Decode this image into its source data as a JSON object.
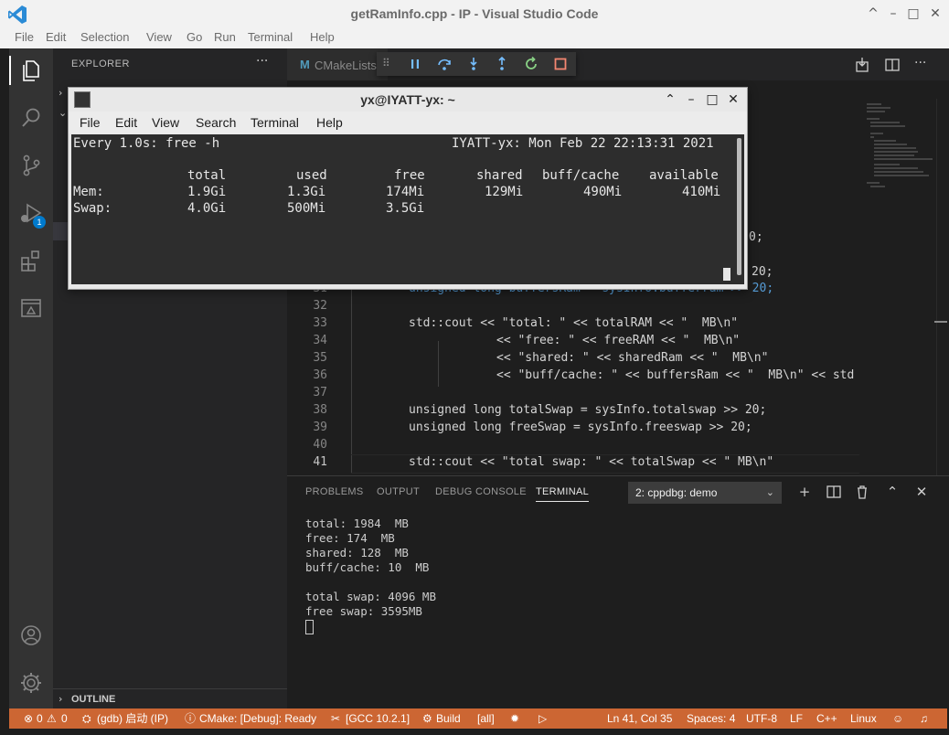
{
  "window": {
    "title": "getRamInfo.cpp - IP - Visual Studio Code",
    "controls": [
      "^",
      "–",
      "□",
      "✕"
    ]
  },
  "menu": [
    "File",
    "Edit",
    "Selection",
    "View",
    "Go",
    "Run",
    "Terminal",
    "Help"
  ],
  "activity_bar": {
    "items": [
      "files-icon",
      "search-icon",
      "source-control-icon",
      "run-debug-icon",
      "extensions-icon",
      "remote-explorer-icon"
    ],
    "debug_badge": "1",
    "bottom": [
      "account-icon",
      "manage-gear-icon"
    ]
  },
  "sidebar": {
    "title": "EXPLORER",
    "more": "···",
    "outline": "OUTLINE"
  },
  "editor": {
    "tab_label": "CMakeLists.",
    "tab_icon_letter": "M",
    "lines": [
      {
        "num": "31",
        "text": "unsigned long buffersRam = sysInfo.bufferram >> 20;"
      },
      {
        "num": "32",
        "text": ""
      },
      {
        "num": "33",
        "text": "std::cout << \"total: \" << totalRAM << \"  MB\\n\""
      },
      {
        "num": "34",
        "text": "<< \"free: \" << freeRAM << \"  MB\\n\""
      },
      {
        "num": "35",
        "text": "<< \"shared: \" << sharedRam << \"  MB\\n\""
      },
      {
        "num": "36",
        "text": "<< \"buff/cache: \" << buffersRam << \"  MB\\n\" << std"
      },
      {
        "num": "37",
        "text": ""
      },
      {
        "num": "38",
        "text": "unsigned long totalSwap = sysInfo.totalswap >> 20;"
      },
      {
        "num": "39",
        "text": "unsigned long freeSwap = sysInfo.freeswap >> 20;"
      },
      {
        "num": "40",
        "text": ""
      },
      {
        "num": "41",
        "text": "std::cout << \"total swap: \" << totalSwap << \" MB\\n\""
      }
    ],
    "fragments": {
      "a": "0;",
      "b": "20;"
    }
  },
  "panel": {
    "tabs": [
      "PROBLEMS",
      "OUTPUT",
      "DEBUG CONSOLE",
      "TERMINAL"
    ],
    "selected_terminal": "2: cppdbg: demo",
    "output": [
      "total: 1984  MB",
      "free: 174  MB",
      "shared: 128  MB",
      "buff/cache: 10  MB",
      "",
      "total swap: 4096 MB",
      "free swap: 3595MB"
    ]
  },
  "statusbar": {
    "errors": "0",
    "warnings": "0",
    "debug": "(gdb) 启动 (IP)",
    "cmake": "CMake: [Debug]: Ready",
    "kit": "[GCC 10.2.1]",
    "build": "Build",
    "target": "[all]",
    "position": "Ln 41, Col 35",
    "spaces": "Spaces: 4",
    "encoding": "UTF-8",
    "eol": "LF",
    "language": "C++",
    "os": "Linux"
  },
  "floating_terminal": {
    "title": "yx@IYATT-yx: ~",
    "menu": [
      "File",
      "Edit",
      "View",
      "Search",
      "Terminal",
      "Help"
    ],
    "header_left": "Every 1.0s: free -h",
    "header_right": "IYATT-yx: Mon Feb 22 22:13:31 2021",
    "table": {
      "columns": [
        "",
        "total",
        "used",
        "free",
        "shared",
        "buff/cache",
        "available"
      ],
      "rows": [
        [
          "Mem:",
          "1.9Gi",
          "1.3Gi",
          "174Mi",
          "129Mi",
          "490Mi",
          "410Mi"
        ],
        [
          "Swap:",
          "4.0Gi",
          "500Mi",
          "3.5Gi",
          "",
          "",
          ""
        ]
      ]
    }
  },
  "colors": {
    "statusbar": "#cc6633",
    "activitybar": "#333333",
    "sidebar": "#252526",
    "editor": "#1e1e1e",
    "accent": "#007acc"
  }
}
